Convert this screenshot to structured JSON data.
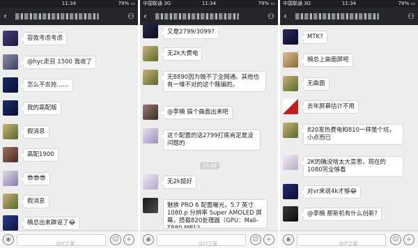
{
  "status": [
    {
      "carrier": "",
      "time": "11:34",
      "battery": "79%"
    },
    {
      "carrier": "中国联通 3G",
      "time": "11:34",
      "battery": "79%"
    },
    {
      "carrier": "中国联通 3G",
      "time": "11:34",
      "battery": "79%"
    }
  ],
  "panels": [
    {
      "messages": [
        {
          "text": "容我考虑考虑"
        },
        {
          "text": "@hyc走召 1500 我收了"
        },
        {
          "text": "怎么不去抢……"
        },
        {
          "text": "我的高配版"
        },
        {
          "text": "假消息"
        },
        {
          "text": "高配1900"
        },
        {
          "text": "😎😎😎"
        },
        {
          "text": "假消息"
        },
        {
          "text": "楠总出来辟谣了😂"
        }
      ]
    },
    {
      "messages": [
        {
          "text": "又是2799/3099?"
        },
        {
          "text": "无2k大费电"
        },
        {
          "text": "无8890因为做不了全网通。其他也有一堆不对的这个瞎编的。"
        },
        {
          "text": "@李楠 搞个曲面出来吧"
        },
        {
          "text": "这个配置的话2799打底肯定是没问题的"
        },
        {
          "text": "无2k挺好"
        },
        {
          "text": "魅族 PRO 6 配置曝光，5.7 英寸 1080.p 分辨率 Super AMOLED 屏幕，搭载820处理器（GPU：Mali-T880 MP12"
        }
      ],
      "timestamp": "10:38"
    },
    {
      "messages": [
        {
          "text": "MTK?"
        },
        {
          "text": "楠总上曲面屏吧"
        },
        {
          "text": "无曲面"
        },
        {
          "text": "去年屏幕估计不用"
        },
        {
          "text": "820发热费电和810一样是个坑，小点而已"
        },
        {
          "text": "2K的确没啥太大意思，现在的1080完全够看"
        },
        {
          "text": "对vr来说4k才够😂"
        },
        {
          "text": "@李楠 那新机有什么创新?"
        }
      ]
    }
  ],
  "icons": {
    "back": "chevron-left-icon",
    "group": "group-icon",
    "voice": "voice-icon",
    "emoji": "emoji-icon",
    "plus": "plus-icon"
  },
  "watermark": "@IT之家"
}
